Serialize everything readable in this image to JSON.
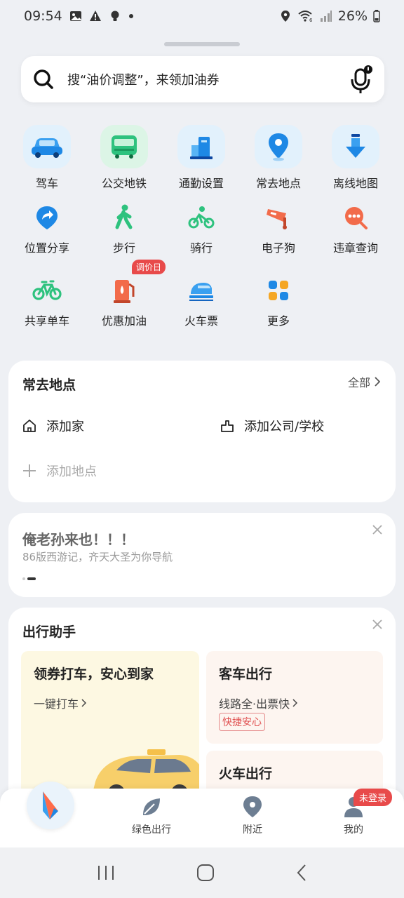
{
  "status": {
    "time": "09:54",
    "battery": "26%"
  },
  "search": {
    "placeholder_text": "搜“油价调整”，来领加油券"
  },
  "grid": {
    "row1": [
      "驾车",
      "公交地铁",
      "通勤设置",
      "常去地点",
      "离线地图"
    ],
    "row2": [
      "位置分享",
      "步行",
      "骑行",
      "电子狗",
      "违章查询"
    ],
    "row3": [
      "共享单车",
      "优惠加油",
      "火车票",
      "更多"
    ],
    "fuel_badge": "调价日"
  },
  "frequent": {
    "title": "常去地点",
    "all_link": "全部",
    "home": "添加家",
    "work": "添加公司/学校",
    "add_place": "添加地点"
  },
  "banner": {
    "title": "俺老孙来也！！！",
    "subtitle": "86版西游记，齐天大圣为你导航"
  },
  "travel": {
    "title": "出行助手",
    "taxi_title": "领券打车，安心到家",
    "taxi_sub": "一键打车",
    "bus_title": "客车出行",
    "bus_sub": "线路全·出票快",
    "bus_tag": "快捷安心",
    "train_title": "火车出行"
  },
  "nav": {
    "green": "绿色出行",
    "nearby": "附近",
    "mine": "我的",
    "login_badge": "未登录"
  },
  "colors": {
    "accent_blue": "#1e88e5",
    "green": "#2ec27e",
    "red_badge": "#e84a4a"
  }
}
